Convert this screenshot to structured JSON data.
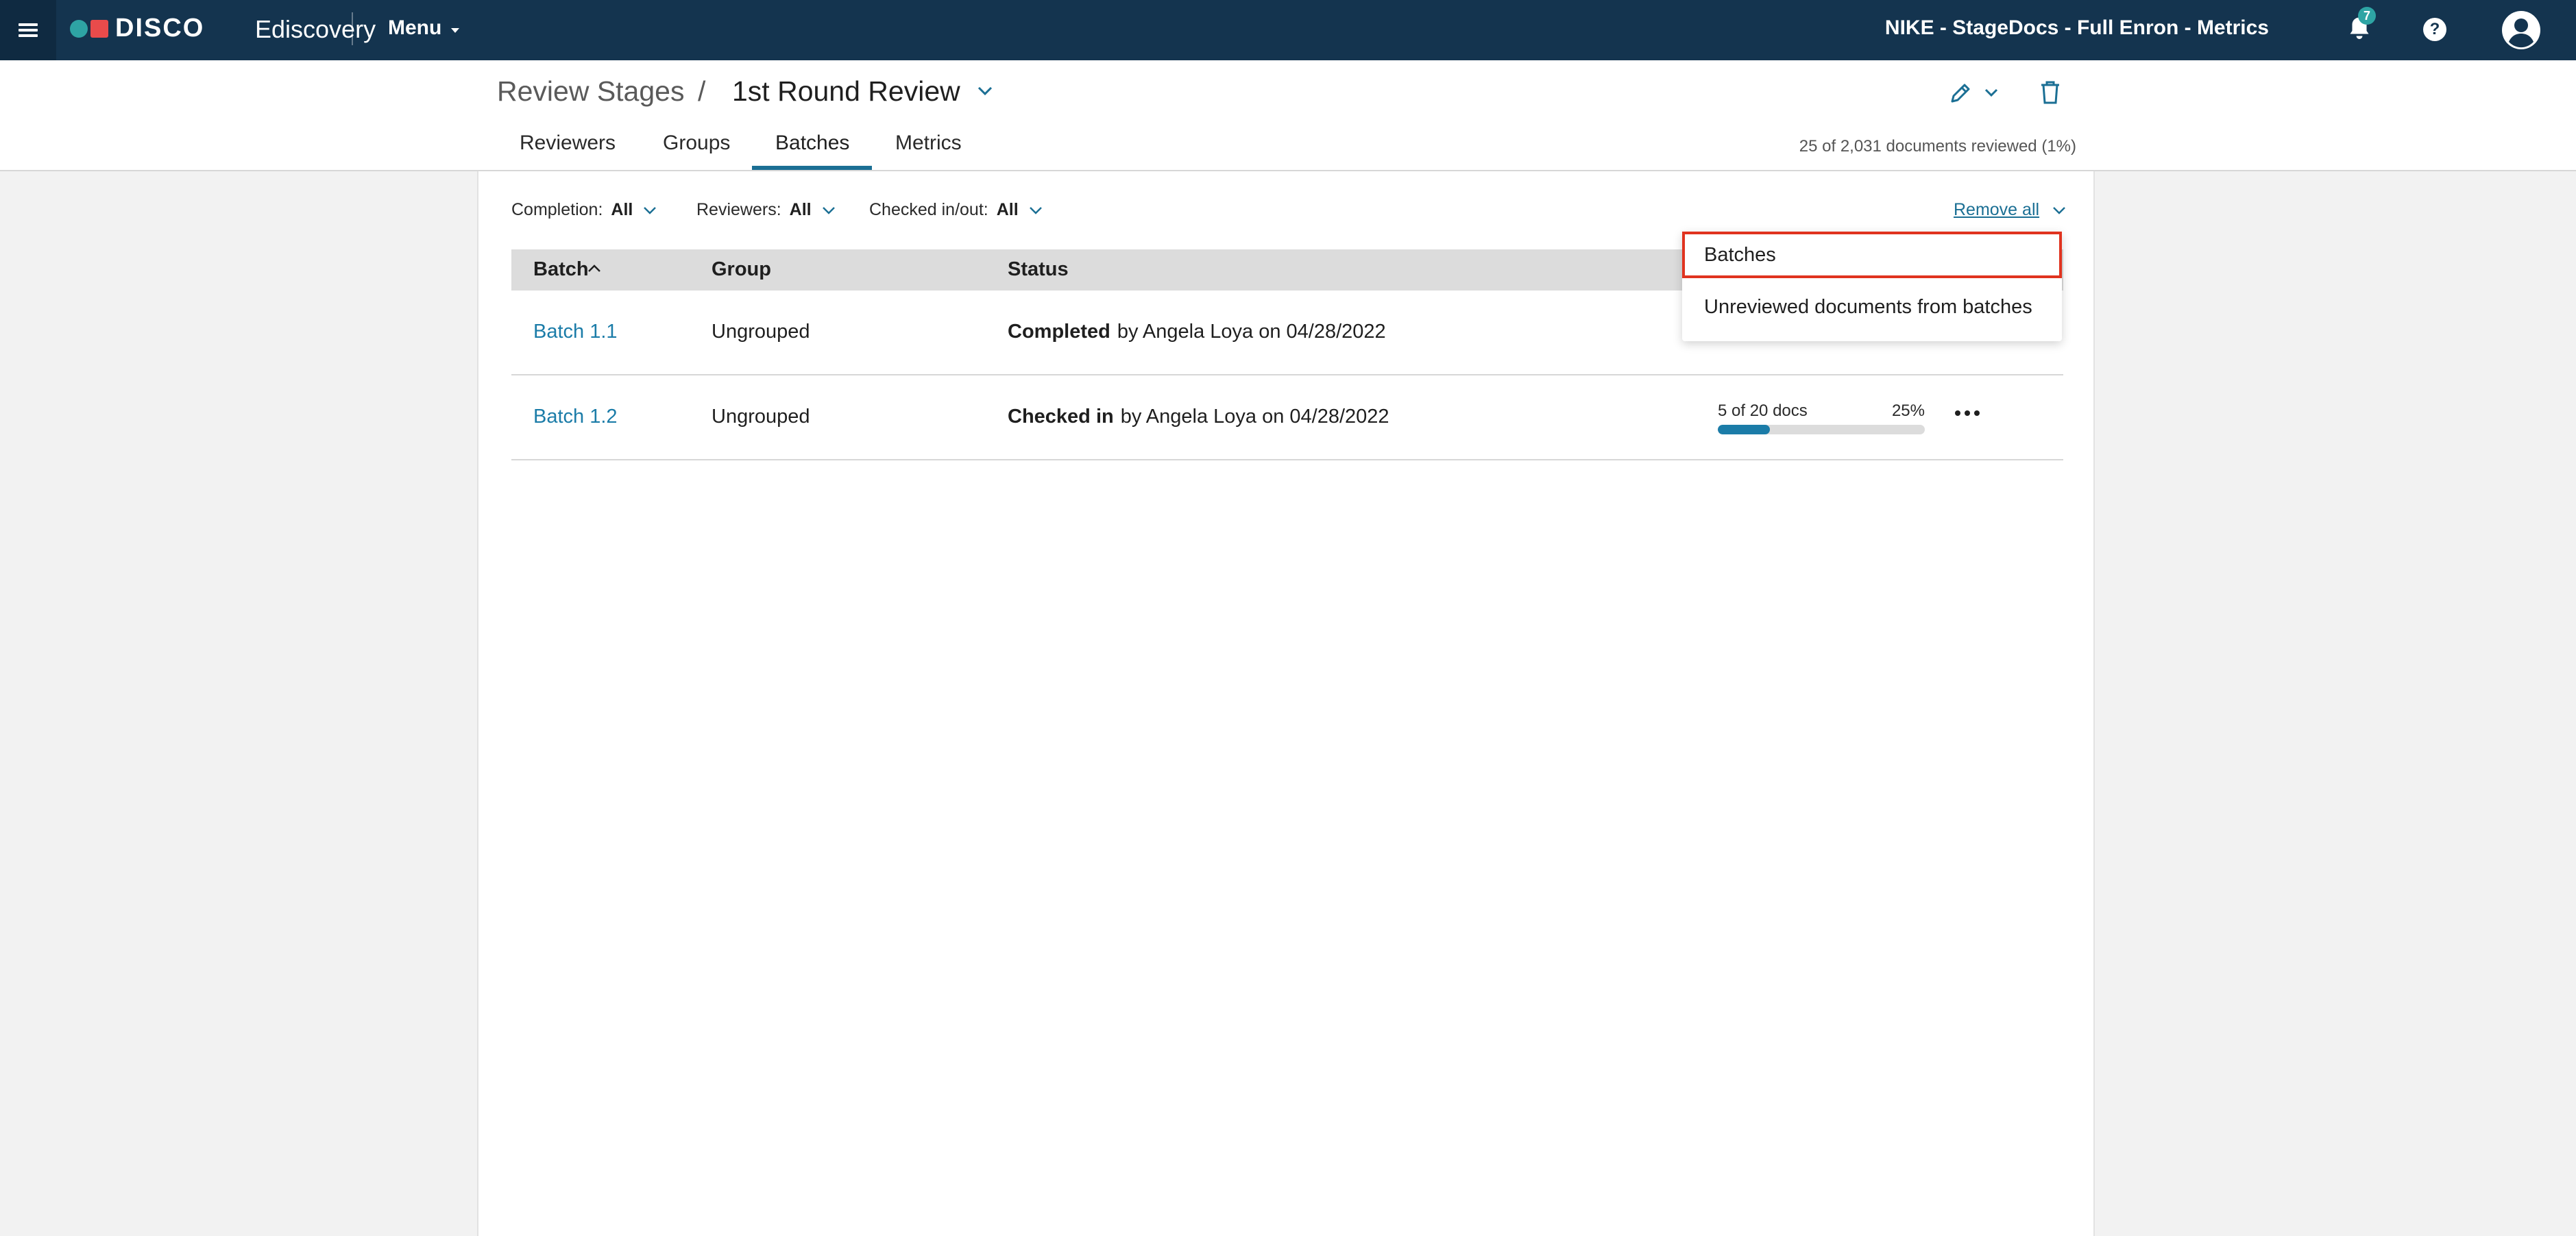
{
  "topbar": {
    "logo_text": "DISCO",
    "logo_sub": "Ediscovery",
    "menu_label": "Menu",
    "project_title": "NIKE - StageDocs - Full Enron - Metrics",
    "notification_count": "7",
    "help_glyph": "?"
  },
  "header": {
    "breadcrumb_root": "Review Stages",
    "breadcrumb_sep": "/",
    "current_stage": "1st Round Review",
    "tabs": [
      {
        "label": "Reviewers"
      },
      {
        "label": "Groups"
      },
      {
        "label": "Batches"
      },
      {
        "label": "Metrics"
      }
    ],
    "active_tab": "Batches",
    "docs_reviewed": "25 of 2,031 documents reviewed (1%)"
  },
  "filters": {
    "completion_label": "Completion:",
    "completion_value": "All",
    "reviewers_label": "Reviewers:",
    "reviewers_value": "All",
    "checked_label": "Checked in/out:",
    "checked_value": "All",
    "remove_all": "Remove all"
  },
  "table": {
    "headers": {
      "batch": "Batch",
      "group": "Group",
      "status": "Status"
    },
    "rows": [
      {
        "batch": "Batch 1.1",
        "group": "Ungrouped",
        "status_bold": "Completed",
        "status_rest": "by Angela Loya on 04/28/2022"
      },
      {
        "batch": "Batch 1.2",
        "group": "Ungrouped",
        "status_bold": "Checked in",
        "status_rest": "by Angela Loya on 04/28/2022",
        "progress_label": "5 of 20 docs",
        "progress_pct": "25%",
        "progress_fraction": 0.25
      }
    ]
  },
  "dropdown": {
    "items": [
      {
        "label": "Batches",
        "highlighted": true
      },
      {
        "label": "Unreviewed documents from batches",
        "highlighted": false
      }
    ]
  },
  "colors": {
    "topbar": "#14344f",
    "accent": "#1b6f94",
    "link": "#1b7ca8",
    "logo_circle": "#2ea4a4",
    "logo_square": "#e94b4b",
    "highlight": "#e0331f"
  },
  "icons": {
    "menu": "hamburger-icon",
    "notifications": "bell-icon",
    "help": "help-icon",
    "user": "user-avatar-icon",
    "edit": "pencil-icon",
    "delete": "trash-icon",
    "more": "more-dots-icon"
  }
}
